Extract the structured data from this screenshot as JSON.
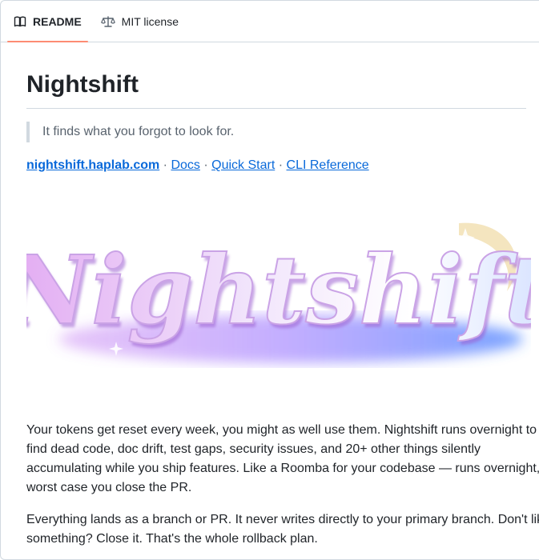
{
  "tabs": [
    {
      "label": "README",
      "icon": "book-icon",
      "active": true
    },
    {
      "label": "MIT license",
      "icon": "scale-icon",
      "active": false
    }
  ],
  "readme": {
    "title": "Nightshift",
    "tagline": "It finds what you forgot to look for.",
    "links": [
      {
        "label": "nightshift.haplab.com"
      },
      {
        "label": "Docs"
      },
      {
        "label": "Quick Start"
      },
      {
        "label": "CLI Reference"
      }
    ],
    "separator": "·",
    "logo_text": "Nightshift",
    "paragraphs": [
      "Your tokens get reset every week, you might as well use them. Nightshift runs overnight to find dead code, doc drift, test gaps, security issues, and 20+ other things silently accumulating while you ship features. Like a Roomba for your codebase — runs overnight, worst case you close the PR.",
      "Everything lands as a branch or PR. It never writes directly to your primary branch. Don't like something? Close it. That's the whole rollback plan."
    ]
  },
  "colors": {
    "accent_underline": "#fd8c73",
    "link": "#0969da",
    "logo_gradient": [
      "#d9a6f0",
      "#c7b6f5",
      "#ffffff",
      "#7aa0ff"
    ],
    "moon": "#f3e2b8"
  }
}
